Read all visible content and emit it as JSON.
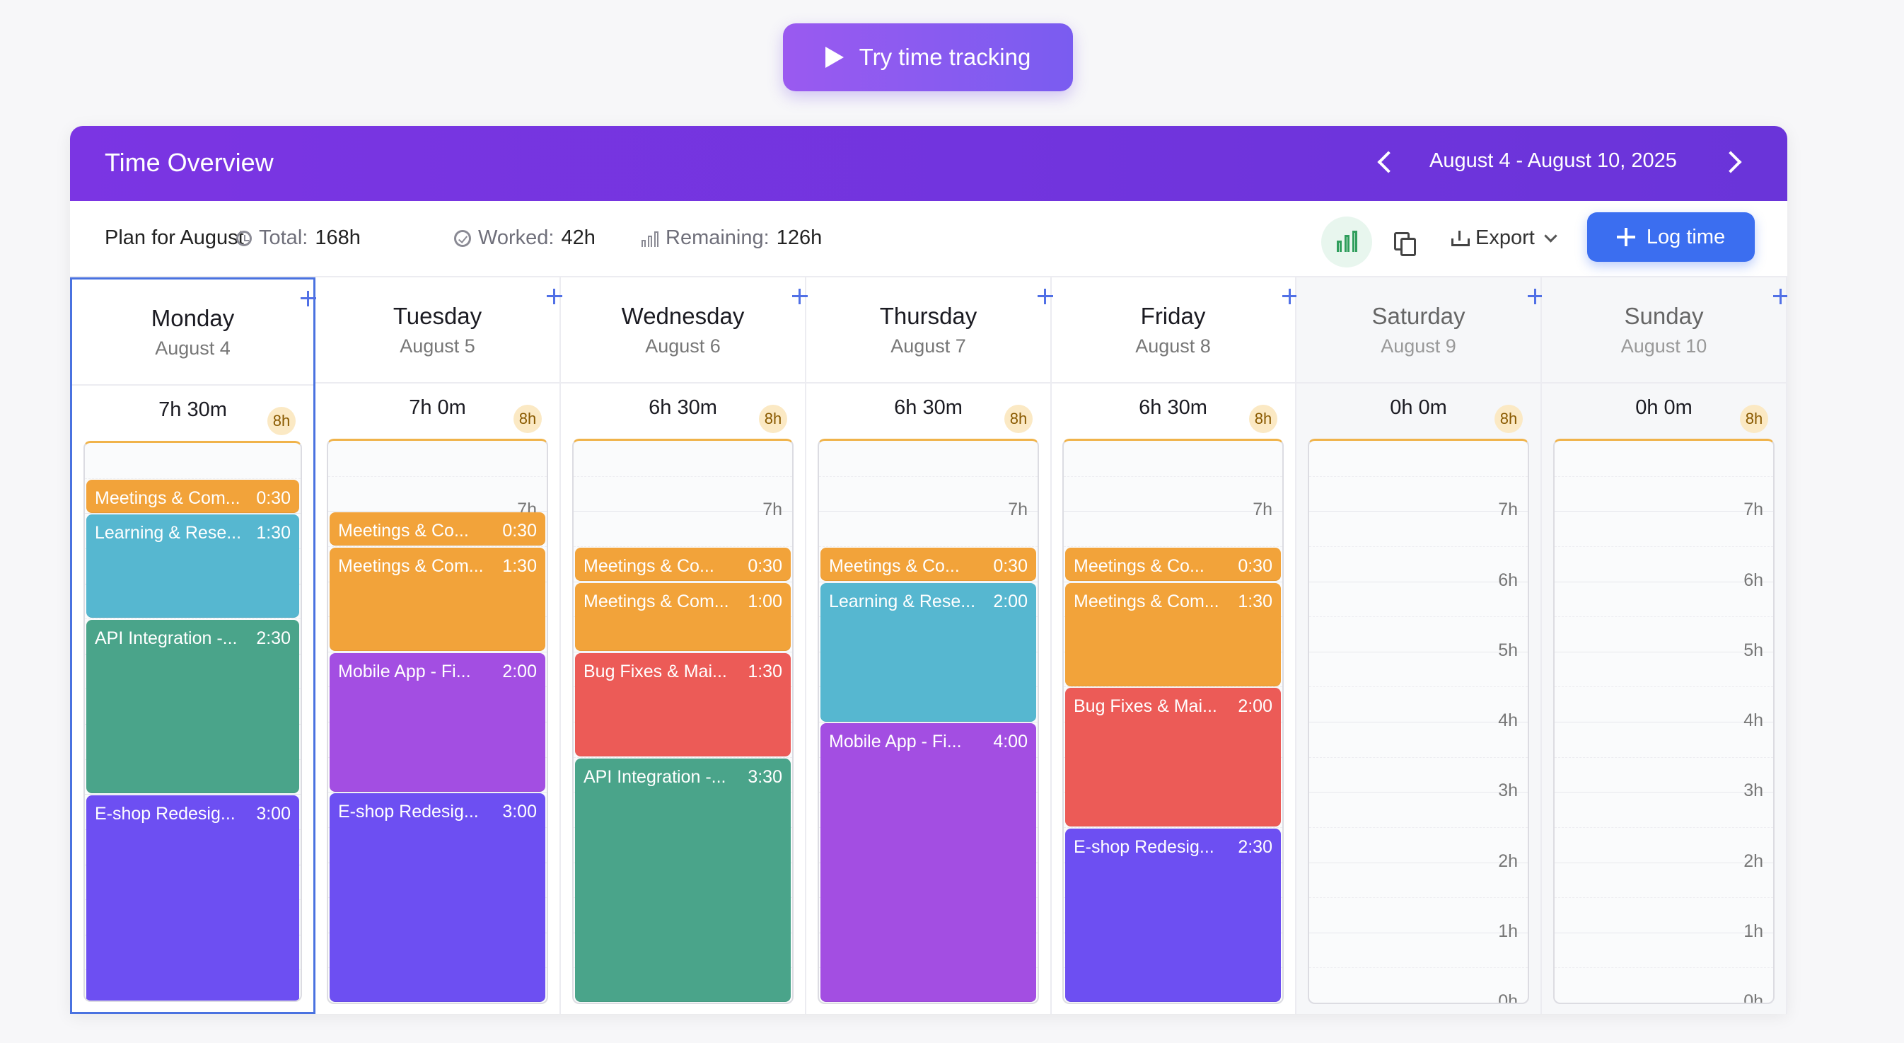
{
  "try_button": {
    "label": "Try time tracking"
  },
  "header": {
    "title": "Time Overview",
    "date_range": "August 4 - August 10, 2025"
  },
  "toolbar": {
    "plan": "Plan for August",
    "total_label": "Total:",
    "total_value": "168h",
    "worked_label": "Worked:",
    "worked_value": "42h",
    "remaining_label": "Remaining:",
    "remaining_value": "126h",
    "export_label": "Export",
    "log_label": "Log time"
  },
  "colors": {
    "meetings": "#f2a33a",
    "learning": "#56b7d0",
    "api": "#4aa48a",
    "mobile": "#a34ee2",
    "eshop": "#6d4ff2",
    "bugs": "#ec5b57"
  },
  "days": [
    {
      "name": "Monday",
      "date": "August 4",
      "total": "7h 30m",
      "cap": "8h",
      "selected": true,
      "weekend": false,
      "scale": [],
      "entries": [
        {
          "label": "Meetings & Com...",
          "duration": "0:30",
          "hours": 0.5,
          "color": "meetings"
        },
        {
          "label": "Learning & Rese...",
          "duration": "1:30",
          "hours": 1.5,
          "color": "learning"
        },
        {
          "label": "API Integration -...",
          "duration": "2:30",
          "hours": 2.5,
          "color": "api"
        },
        {
          "label": "E-shop Redesig...",
          "duration": "3:00",
          "hours": 3.0,
          "color": "eshop"
        }
      ]
    },
    {
      "name": "Tuesday",
      "date": "August 5",
      "total": "7h 0m",
      "cap": "8h",
      "selected": false,
      "weekend": false,
      "scale": [
        "7h"
      ],
      "entries": [
        {
          "label": "Meetings & Co...",
          "duration": "0:30",
          "hours": 0.5,
          "color": "meetings"
        },
        {
          "label": "Meetings & Com...",
          "duration": "1:30",
          "hours": 1.5,
          "color": "meetings"
        },
        {
          "label": "Mobile App - Fi...",
          "duration": "2:00",
          "hours": 2.0,
          "color": "mobile"
        },
        {
          "label": "E-shop Redesig...",
          "duration": "3:00",
          "hours": 3.0,
          "color": "eshop"
        }
      ]
    },
    {
      "name": "Wednesday",
      "date": "August 6",
      "total": "6h 30m",
      "cap": "8h",
      "selected": false,
      "weekend": false,
      "scale": [
        "7h"
      ],
      "entries": [
        {
          "label": "Meetings & Co...",
          "duration": "0:30",
          "hours": 0.5,
          "color": "meetings"
        },
        {
          "label": "Meetings & Com...",
          "duration": "1:00",
          "hours": 1.0,
          "color": "meetings"
        },
        {
          "label": "Bug Fixes & Mai...",
          "duration": "1:30",
          "hours": 1.5,
          "color": "bugs"
        },
        {
          "label": "API Integration -...",
          "duration": "3:30",
          "hours": 3.5,
          "color": "api"
        }
      ]
    },
    {
      "name": "Thursday",
      "date": "August 7",
      "total": "6h 30m",
      "cap": "8h",
      "selected": false,
      "weekend": false,
      "scale": [
        "7h"
      ],
      "entries": [
        {
          "label": "Meetings & Co...",
          "duration": "0:30",
          "hours": 0.5,
          "color": "meetings"
        },
        {
          "label": "Learning & Rese...",
          "duration": "2:00",
          "hours": 2.0,
          "color": "learning"
        },
        {
          "label": "Mobile App - Fi...",
          "duration": "4:00",
          "hours": 4.0,
          "color": "mobile"
        }
      ]
    },
    {
      "name": "Friday",
      "date": "August 8",
      "total": "6h 30m",
      "cap": "8h",
      "selected": false,
      "weekend": false,
      "scale": [
        "7h"
      ],
      "entries": [
        {
          "label": "Meetings & Co...",
          "duration": "0:30",
          "hours": 0.5,
          "color": "meetings"
        },
        {
          "label": "Meetings & Com...",
          "duration": "1:30",
          "hours": 1.5,
          "color": "meetings"
        },
        {
          "label": "Bug Fixes & Mai...",
          "duration": "2:00",
          "hours": 2.0,
          "color": "bugs"
        },
        {
          "label": "E-shop Redesig...",
          "duration": "2:30",
          "hours": 2.5,
          "color": "eshop"
        }
      ]
    },
    {
      "name": "Saturday",
      "date": "August 9",
      "total": "0h 0m",
      "cap": "8h",
      "selected": false,
      "weekend": true,
      "scale": [
        "7h",
        "6h",
        "5h",
        "4h",
        "3h",
        "2h",
        "1h",
        "0h"
      ],
      "entries": []
    },
    {
      "name": "Sunday",
      "date": "August 10",
      "total": "0h 0m",
      "cap": "8h",
      "selected": false,
      "weekend": true,
      "scale": [
        "7h",
        "6h",
        "5h",
        "4h",
        "3h",
        "2h",
        "1h",
        "0h"
      ],
      "entries": []
    }
  ]
}
